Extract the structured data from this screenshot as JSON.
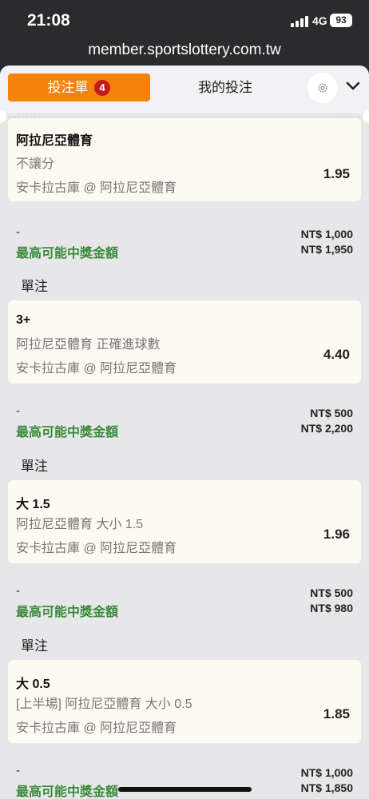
{
  "status": {
    "time": "21:08",
    "network": "4G",
    "battery": "93"
  },
  "browser": {
    "url": "member.sportslottery.com.tw"
  },
  "tabs": {
    "active": "投注單",
    "badge": "4",
    "mine": "我的投注"
  },
  "first_card": {
    "selection": "阿拉尼亞體育",
    "market": "不讓分",
    "match": "安卡拉古庫 @ 阿拉尼亞體育",
    "odds": "1.95"
  },
  "slips": [
    {
      "stake_label": "-",
      "max_win_label": "最高可能中獎金額",
      "stake": "NT$ 1,000",
      "max_win": "NT$ 1,950"
    },
    {
      "stake_label": "-",
      "max_win_label": "最高可能中獎金額",
      "stake": "NT$ 500",
      "max_win": "NT$ 2,200"
    },
    {
      "stake_label": "-",
      "max_win_label": "最高可能中獎金額",
      "stake": "NT$ 500",
      "max_win": "NT$ 980"
    },
    {
      "stake_label": "-",
      "max_win_label": "最高可能中獎金額",
      "stake": "NT$ 1,000",
      "max_win": "NT$ 1,850"
    }
  ],
  "singles": [
    {
      "section_label": "單注",
      "selection": "3+",
      "market": "阿拉尼亞體育 正確進球數",
      "match": "安卡拉古庫 @ 阿拉尼亞體育",
      "odds": "4.40"
    },
    {
      "section_label": "單注",
      "selection": "大 1.5",
      "market": "阿拉尼亞體育 大小 1.5",
      "match": "安卡拉古庫 @ 阿拉尼亞體育",
      "odds": "1.96"
    },
    {
      "section_label": "單注",
      "selection": "大 0.5",
      "market": "[上半場] 阿拉尼亞體育 大小 0.5",
      "match": "安卡拉古庫 @ 阿拉尼亞體育",
      "odds": "1.85"
    }
  ]
}
